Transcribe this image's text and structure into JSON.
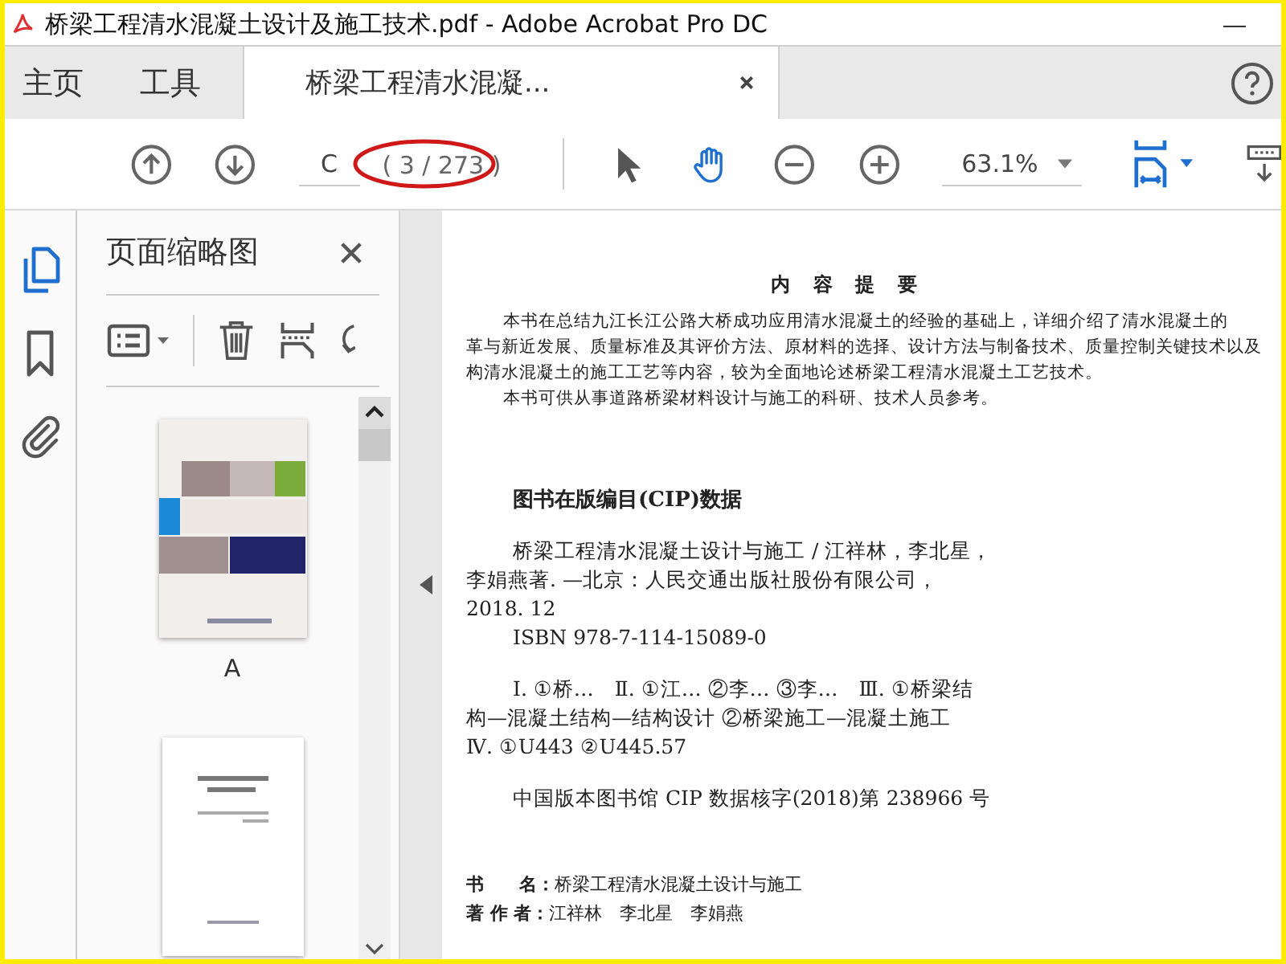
{
  "title_bar": {
    "title": "桥梁工程清水混凝土设计及施工技术.pdf - Adobe Acrobat Pro DC",
    "minimize": "—"
  },
  "tabs": [
    {
      "label": "主页",
      "selected": false,
      "closable": false
    },
    {
      "label": "工具",
      "selected": false,
      "closable": false
    },
    {
      "label": "桥梁工程清水混凝...",
      "selected": true,
      "closable": true
    }
  ],
  "toolbar": {
    "page_input": "C",
    "page_count": "( 3 / 273 )",
    "page_count_circled": true,
    "zoom": "63.1%",
    "tools": [
      {
        "kind": "select",
        "selected": false
      },
      {
        "kind": "hand",
        "selected": true
      }
    ]
  },
  "side_rail": [
    {
      "kind": "pages",
      "selected": true
    },
    {
      "kind": "bookmarks",
      "selected": false
    },
    {
      "kind": "attachments",
      "selected": false
    }
  ],
  "thumbnails_panel": {
    "title": "页面缩略图",
    "thumbnails": [
      {
        "kind": "cover",
        "label": "A",
        "selected": false
      },
      {
        "kind": "title_page",
        "selected": false
      }
    ]
  },
  "document": {
    "abstract_heading": "内 容 提 要",
    "abstract_lines": [
      {
        "text": "本书在总结九江长江公路大桥成功应用清水混凝土的经验的基础上，详细介绍了清水混凝土的",
        "indent": true
      },
      {
        "text": "革与新近发展、质量标准及其评价方法、原材料的选择、设计方法与制备技术、质量控制关键技术以及",
        "indent": false
      },
      {
        "text": "构清水混凝土的施工工艺等内容，较为全面地论述桥梁工程清水混凝土工艺技术。",
        "indent": false
      },
      {
        "text": "本书可供从事道路桥梁材料设计与施工的科研、技术人员参考。",
        "indent": true
      }
    ],
    "cip_heading": "图书在版编目(CIP)数据",
    "cip_blocks": [
      [
        {
          "text": "桥梁工程清水混凝土设计与施工 / 江祥林，李北星，",
          "indent": true
        },
        {
          "text": "李娟燕著. —北京：人民交通出版社股份有限公司，",
          "indent": false
        },
        {
          "text": "2018. 12",
          "indent": false
        },
        {
          "text": "ISBN 978-7-114-15089-0",
          "indent": true
        }
      ],
      [
        {
          "text": "Ⅰ. ①桥…　Ⅱ. ①江… ②李… ③李…　Ⅲ. ①桥梁结",
          "indent": true
        },
        {
          "text": "构—混凝土结构—结构设计 ②桥梁施工—混凝土施工",
          "indent": false
        },
        {
          "text": "Ⅳ. ①U443 ②U445.57",
          "indent": false
        }
      ],
      [
        {
          "text": "中国版本图书馆 CIP 数据核字(2018)第 238966 号",
          "indent": true
        }
      ]
    ],
    "colophon": [
      {
        "label": "书　　名：",
        "value": "桥梁工程清水混凝土设计与施工"
      },
      {
        "label": "著 作 者：",
        "value": "江祥林　李北星　李娟燕"
      }
    ]
  }
}
